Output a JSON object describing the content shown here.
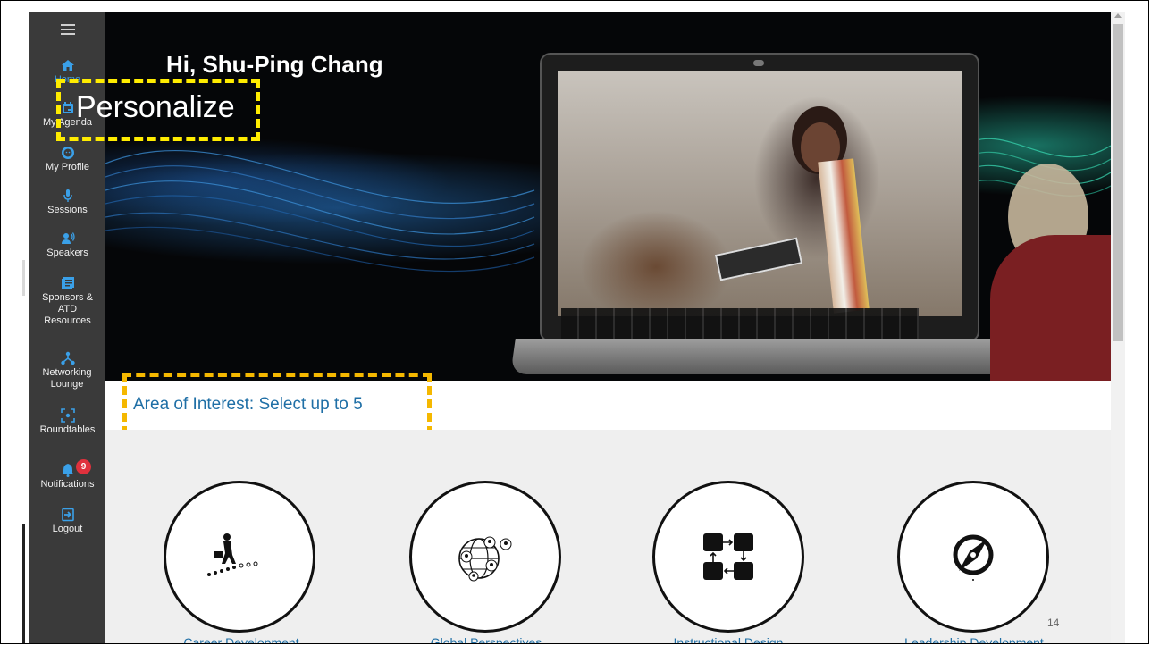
{
  "sidebar": {
    "menu_icon": "hamburger-icon",
    "items": [
      {
        "label": "Home",
        "icon": "home-icon",
        "active": true
      },
      {
        "label": "My Agenda",
        "icon": "calendar-icon"
      },
      {
        "label": "My Profile",
        "icon": "profile-icon"
      },
      {
        "label": "Sessions",
        "icon": "microphone-icon"
      },
      {
        "label": "Speakers",
        "icon": "speaker-icon"
      },
      {
        "label": "Sponsors & ATD Resources",
        "icon": "document-icon"
      },
      {
        "label": "Networking Lounge",
        "icon": "network-icon"
      },
      {
        "label": "Roundtables",
        "icon": "roundtable-icon"
      },
      {
        "label": "Notifications",
        "icon": "bell-icon",
        "badge": "9"
      },
      {
        "label": "Logout",
        "icon": "logout-icon"
      }
    ]
  },
  "hero": {
    "greeting": "Hi, Shu-Ping Chang",
    "personalize": "Personalize"
  },
  "interest": {
    "title": "Area of Interest:  Select up to 5"
  },
  "cards": [
    {
      "label": "Career Development",
      "icon": "career-stairs-icon"
    },
    {
      "label": "Global Perspectives",
      "icon": "globe-people-icon"
    },
    {
      "label": "Instructional Design",
      "icon": "flow-blocks-icon"
    },
    {
      "label": "Leadership Development",
      "icon": "compass-icon"
    }
  ],
  "page_number": "14",
  "colors": {
    "sidebar_bg": "#3a3a3a",
    "active_blue": "#3aa0e8",
    "link_blue": "#1f6fa6",
    "highlight_yellow": "#ffec00",
    "highlight_orange": "#f5b800",
    "badge_red": "#e0313d"
  }
}
